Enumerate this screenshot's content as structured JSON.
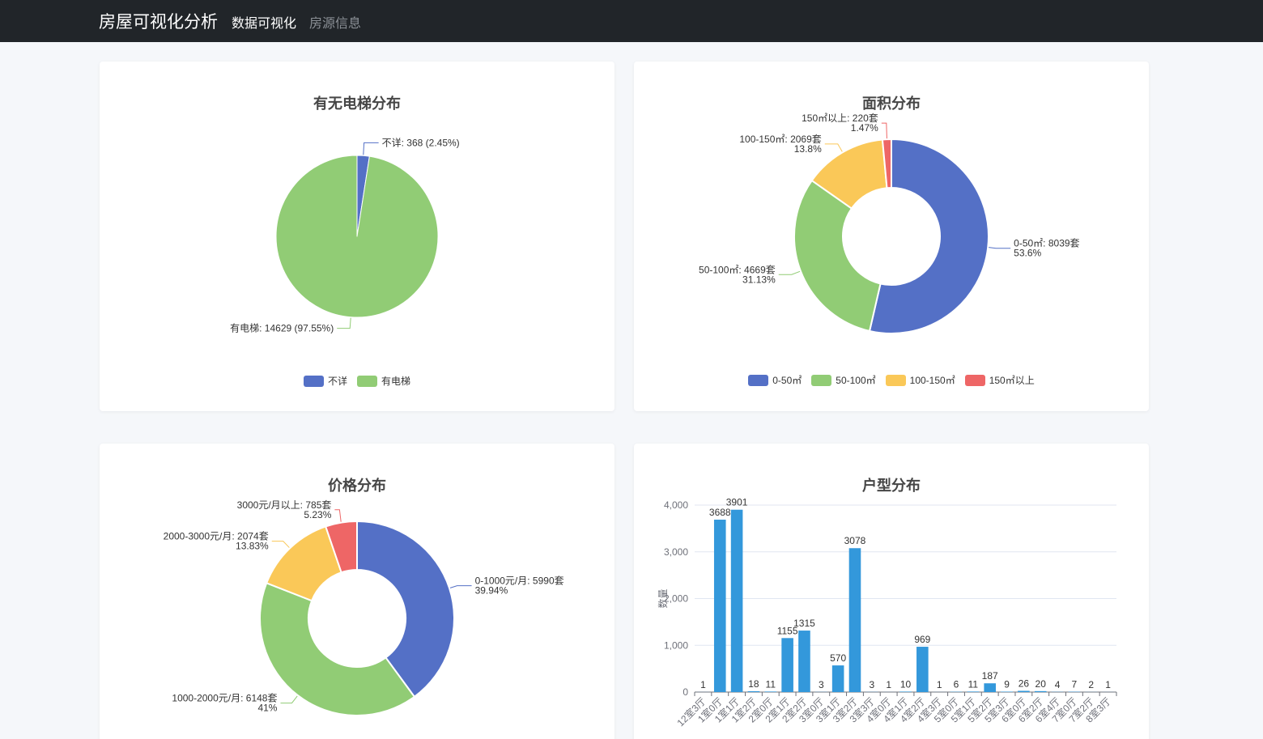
{
  "nav": {
    "brand": "房屋可视化分析",
    "links": [
      {
        "label": "数据可视化",
        "active": true
      },
      {
        "label": "房源信息",
        "active": false
      }
    ]
  },
  "colors": {
    "blue": "#5470c6",
    "green": "#91cc75",
    "yellow": "#fac858",
    "red": "#ee6666",
    "bar": "#3398db"
  },
  "chart_data": [
    {
      "id": "elevator",
      "type": "pie",
      "title": "有无电梯分布",
      "slices": [
        {
          "name": "不详",
          "value": 368,
          "label": "不详: 368 (2.45%)",
          "color": "#5470c6"
        },
        {
          "name": "有电梯",
          "value": 14629,
          "label": "有电梯: 14629 (97.55%)",
          "color": "#91cc75"
        }
      ],
      "legend": [
        "不详",
        "有电梯"
      ],
      "legend_position": "bottom"
    },
    {
      "id": "area",
      "type": "pie",
      "variant": "donut",
      "title": "面积分布",
      "slices": [
        {
          "name": "0-50㎡",
          "value": 8039,
          "label1": "0-50㎡: 8039套",
          "label2": "53.6%",
          "color": "#5470c6"
        },
        {
          "name": "50-100㎡",
          "value": 4669,
          "label1": "50-100㎡: 4669套",
          "label2": "31.13%",
          "color": "#91cc75"
        },
        {
          "name": "100-150㎡",
          "value": 2069,
          "label1": "100-150㎡: 2069套",
          "label2": "13.8%",
          "color": "#fac858"
        },
        {
          "name": "150㎡以上",
          "value": 220,
          "label1": "150㎡以上: 220套",
          "label2": "1.47%",
          "color": "#ee6666"
        }
      ],
      "legend": [
        "0-50㎡",
        "50-100㎡",
        "100-150㎡",
        "150㎡以上"
      ],
      "legend_position": "bottom"
    },
    {
      "id": "price",
      "type": "pie",
      "variant": "donut",
      "title": "价格分布",
      "slices": [
        {
          "name": "0-1000元/月",
          "value": 5990,
          "label1": "0-1000元/月: 5990套",
          "label2": "39.94%",
          "color": "#5470c6"
        },
        {
          "name": "1000-2000元/月",
          "value": 6148,
          "label1": "1000-2000元/月: 6148套",
          "label2": "41%",
          "color": "#91cc75"
        },
        {
          "name": "2000-3000元/月",
          "value": 2074,
          "label1": "2000-3000元/月: 2074套",
          "label2": "13.83%",
          "color": "#fac858"
        },
        {
          "name": "3000元/月以上",
          "value": 785,
          "label1": "3000元/月以上: 785套",
          "label2": "5.23%",
          "color": "#ee6666"
        }
      ]
    },
    {
      "id": "layout",
      "type": "bar",
      "title": "户型分布",
      "ylabel": "数量",
      "ylim": [
        0,
        4000
      ],
      "yticks": [
        0,
        1000,
        2000,
        3000,
        4000
      ],
      "ytick_labels": [
        "0",
        "1,000",
        "2,000",
        "3,000",
        "4,000"
      ],
      "grid": true,
      "categories": [
        "12室3厅",
        "1室0厅",
        "1室1厅",
        "1室2厅",
        "2室0厅",
        "2室1厅",
        "2室2厅",
        "3室0厅",
        "3室1厅",
        "3室2厅",
        "3室3厅",
        "4室0厅",
        "4室1厅",
        "4室2厅",
        "4室3厅",
        "5室0厅",
        "5室1厅",
        "5室2厅",
        "5室3厅",
        "6室0厅",
        "6室2厅",
        "6室4厅",
        "7室0厅",
        "7室2厅",
        "8室3厅"
      ],
      "values": [
        1,
        3688,
        3901,
        18,
        11,
        1155,
        1315,
        3,
        570,
        3078,
        3,
        1,
        10,
        969,
        1,
        6,
        11,
        187,
        9,
        26,
        20,
        4,
        7,
        2,
        1
      ],
      "color": "#3398db"
    }
  ]
}
